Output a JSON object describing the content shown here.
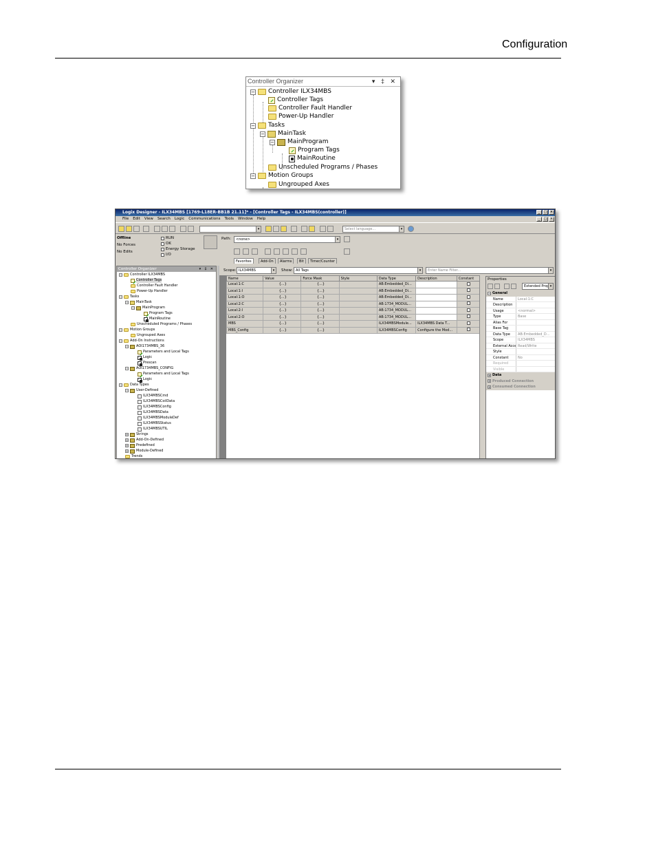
{
  "page": {
    "header": "Configuration"
  },
  "organizer_zoom": {
    "title": "Controller Organizer",
    "controls": "▾ ‡ ✕",
    "items": [
      "Controller ILX34MBS",
      "Controller Tags",
      "Controller Fault Handler",
      "Power-Up Handler",
      "Tasks",
      "MainTask",
      "MainProgram",
      "Program Tags",
      "MainRoutine",
      "Unscheduled Programs / Phases",
      "Motion Groups",
      "Ungrouped Axes"
    ]
  },
  "window": {
    "title": "Logix Designer - ILX34MBS [1769-L18ER-BB1B 21.11]* - [Controller Tags - ILX34MBS(controller)]",
    "menu": [
      "File",
      "Edit",
      "View",
      "Search",
      "Logic",
      "Communications",
      "Tools",
      "Window",
      "Help"
    ],
    "language_placeholder": "Select language...",
    "status": {
      "mode": "Offline",
      "forces": "No Forces",
      "edits": "No Edits",
      "run": "RUN",
      "ok": "OK",
      "energy": "Energy Storage",
      "io": "I/O"
    },
    "path_label": "Path:",
    "path_value": "<none>",
    "palette_tabs": [
      "Favorites",
      "Add-On",
      "Alarms",
      "Bit",
      "Timer/Counter"
    ],
    "organizer": {
      "title": "Controller Organizer",
      "controls": "▾ ‡ ✕",
      "items": [
        "Controller ILX34MBS",
        "Controller Tags",
        "Controller Fault Handler",
        "Power-Up Handler",
        "Tasks",
        "MainTask",
        "MainProgram",
        "Program Tags",
        "MainRoutine",
        "Unscheduled Programs / Phases",
        "Motion Groups",
        "Ungrouped Axes",
        "Add-On Instructions",
        "AOI1734MBS_36",
        "Parameters and Local Tags",
        "Logic",
        "Prescan",
        "AOI1734MBS_CONFIG",
        "Parameters and Local Tags",
        "Logic",
        "Data Types",
        "User-Defined",
        "ILX34MBSCmd",
        "ILX34MBSCoilData",
        "ILX34MBSConfig",
        "ILX34MBSData",
        "ILX34MBSModuleDef",
        "ILX34MBSStatus",
        "ILX34MBSUTIL",
        "Strings",
        "Add-On-Defined",
        "Predefined",
        "Module-Defined",
        "Trends"
      ]
    },
    "tags": {
      "scope_label": "Scope:",
      "scope_value": "ILX34MBS",
      "show_label": "Show:",
      "show_value": "All Tags",
      "filter_placeholder": "Enter Name Filter...",
      "columns": [
        "Name",
        "Value",
        "Force Mask",
        "Style",
        "Data Type",
        "Description",
        "Constant"
      ],
      "rows": [
        {
          "name": "Local:1:C",
          "value": "{...}",
          "force": "{...}",
          "style": "",
          "type": "AB:Embedded_Di...",
          "desc": ""
        },
        {
          "name": "Local:1:I",
          "value": "{...}",
          "force": "{...}",
          "style": "",
          "type": "AB:Embedded_Di...",
          "desc": ""
        },
        {
          "name": "Local:1:O",
          "value": "{...}",
          "force": "{...}",
          "style": "",
          "type": "AB:Embedded_Di...",
          "desc": ""
        },
        {
          "name": "Local:2:C",
          "value": "{...}",
          "force": "{...}",
          "style": "",
          "type": "AB:1734_MODUL...",
          "desc": ""
        },
        {
          "name": "Local:2:I",
          "value": "{...}",
          "force": "{...}",
          "style": "",
          "type": "AB:1734_MODUL...",
          "desc": ""
        },
        {
          "name": "Local:2:O",
          "value": "{...}",
          "force": "{...}",
          "style": "",
          "type": "AB:1734_MODUL...",
          "desc": ""
        },
        {
          "name": "MBS",
          "value": "{...}",
          "force": "{...}",
          "style": "",
          "type": "ILX34MBSModule...",
          "desc": "ILX34MBS Data T..."
        },
        {
          "name": "MBS_Config",
          "value": "{...}",
          "force": "{...}",
          "style": "",
          "type": "ILX34MBSConfig",
          "desc": "Configure the Mod..."
        }
      ]
    },
    "properties": {
      "title": "Properties",
      "view": "Extended Prop",
      "general": "General",
      "rows": [
        {
          "k": "Name",
          "v": "Local:1:C"
        },
        {
          "k": "Description",
          "v": ""
        },
        {
          "k": "Usage",
          "v": "<normal>"
        },
        {
          "k": "Type",
          "v": "Base"
        },
        {
          "k": "Alias For",
          "v": ""
        },
        {
          "k": "Base Tag",
          "v": ""
        },
        {
          "k": "Data Type",
          "v": "AB:Embedded_D..."
        },
        {
          "k": "Scope",
          "v": "ILX34MBS"
        },
        {
          "k": "External Acce...",
          "v": "Read/Write"
        },
        {
          "k": "Style",
          "v": ""
        },
        {
          "k": "Constant",
          "v": "No"
        },
        {
          "k": "Required",
          "v": ""
        },
        {
          "k": "Visible",
          "v": ""
        }
      ],
      "data": "Data",
      "produced": "Produced Connection",
      "consumed": "Consumed Connection"
    }
  }
}
